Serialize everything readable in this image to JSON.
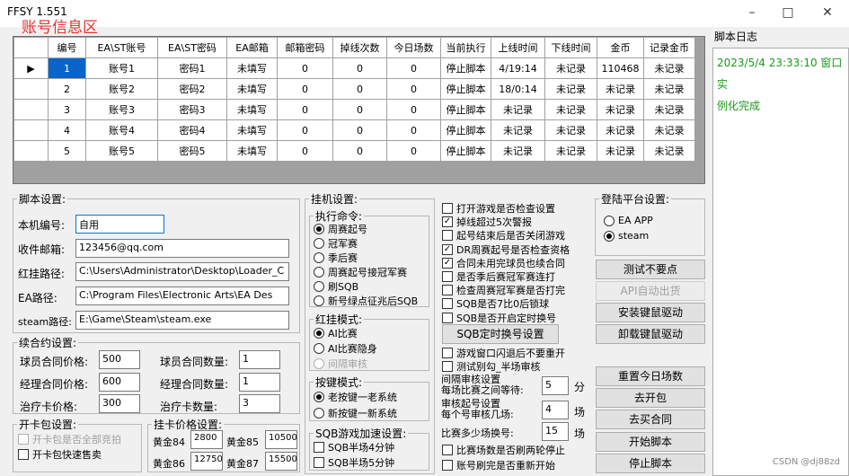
{
  "window": {
    "title": "FFSY 1.551",
    "overlay_label": "账号信息区",
    "minimize": "–",
    "maximize": "□",
    "close": "✕"
  },
  "table": {
    "headers": [
      "编号",
      "EA\\ST账号",
      "EA\\ST密码",
      "EA邮箱",
      "邮箱密码",
      "掉线次数",
      "今日场数",
      "当前执行",
      "上线时间",
      "下线时间",
      "金币",
      "记录金币"
    ],
    "rows": [
      [
        "1",
        "账号1",
        "密码1",
        "未填写",
        "0",
        "0",
        "0",
        "停止脚本",
        "4/19:14",
        "未记录",
        "110468",
        "未记录"
      ],
      [
        "2",
        "账号2",
        "密码2",
        "未填写",
        "0",
        "0",
        "0",
        "停止脚本",
        "18/0:14",
        "未记录",
        "未记录",
        "未记录"
      ],
      [
        "3",
        "账号3",
        "密码3",
        "未填写",
        "0",
        "0",
        "0",
        "停止脚本",
        "未记录",
        "未记录",
        "未记录",
        "未记录"
      ],
      [
        "4",
        "账号4",
        "密码4",
        "未填写",
        "0",
        "0",
        "0",
        "停止脚本",
        "未记录",
        "未记录",
        "未记录",
        "未记录"
      ],
      [
        "5",
        "账号5",
        "密码5",
        "未填写",
        "0",
        "0",
        "0",
        "停止脚本",
        "未记录",
        "未记录",
        "未记录",
        "未记录"
      ]
    ],
    "current_row_marker": "▶"
  },
  "script_settings": {
    "legend": "脚本设置:",
    "machine_label": "本机编号:",
    "machine_value": "自用",
    "email_label": "收件邮箱:",
    "email_value": "123456@qq.com",
    "redhang_label": "红挂路径:",
    "redhang_value": "C:\\Users\\Administrator\\Desktop\\Loader_C",
    "ea_label": "EA路径:",
    "ea_value": "C:\\Program Files\\Electronic Arts\\EA Des",
    "steam_label": "steam路径:",
    "steam_value": "E:\\Game\\Steam\\steam.exe"
  },
  "contract": {
    "legend": "续合约设置:",
    "player_price_label": "球员合同价格:",
    "player_price": "500",
    "player_qty_label": "球员合同数量:",
    "player_qty": "1",
    "manager_price_label": "经理合同价格:",
    "manager_price": "600",
    "manager_qty_label": "经理合同数量:",
    "manager_qty": "1",
    "heal_price_label": "治疗卡价格:",
    "heal_price": "300",
    "heal_qty_label": "治疗卡数量:",
    "heal_qty": "3"
  },
  "pack": {
    "legend": "开卡包设置:",
    "opt1": "开卡包是否全部竞拍",
    "opt2": "开卡包快速售卖"
  },
  "card_price": {
    "legend": "挂卡价格设置:",
    "g84_label": "黄金84",
    "g84": "2800",
    "g85_label": "黄金85",
    "g85": "10500",
    "g86_label": "黄金86",
    "g86": "12750",
    "g87_label": "黄金87",
    "g87": "15500"
  },
  "hang": {
    "legend": "挂机设置:",
    "exec_legend": "执行命令:",
    "exec_options": [
      "周赛起号",
      "冠军赛",
      "季后赛",
      "周赛起号接冠军赛",
      "刷SQB",
      "新号绿点征兆后SQB"
    ],
    "mode_legend": "红挂模式:",
    "mode_options": [
      "AI比赛",
      "AI比赛隐身",
      "间隔审核"
    ],
    "key_legend": "按键模式:",
    "key_options": [
      "老按键一老系统",
      "新按键一新系统"
    ],
    "sqb_legend": "SQB游戏加速设置:",
    "sqb_options": [
      "SQB半场4分钟",
      "SQB半场5分钟"
    ]
  },
  "checks": {
    "items1": [
      "打开游戏是否检查设置",
      "掉线超过5次警报",
      "起号结束后是否关闭游戏",
      "DR周赛起号是否检查资格",
      "合同未用完球员也续合同",
      "是否季后赛冠军赛连打",
      "检查周赛冠军赛是否打完",
      "SQB是否7比0后锁球",
      "SQB是否开启定时换号"
    ],
    "items1_checked": [
      false,
      true,
      false,
      true,
      true,
      false,
      false,
      false,
      false
    ],
    "sqb_timer_button": "SQB定时换号设置",
    "items2": [
      "游戏窗口闪退后不要重开",
      "测试别勾_半场审核"
    ],
    "interval_label1": "间隔审核设置",
    "interval_label2": "每场比赛之间等待:",
    "interval_value": "5",
    "interval_unit": "分",
    "review_label1": "审核起号设置",
    "review_label2": "每个号审核几场:",
    "review_value": "4",
    "review_unit": "场",
    "switch_label": "比赛多少场换号:",
    "switch_value": "15",
    "switch_unit": "场",
    "items3": [
      "比赛场数是否刷两轮停止",
      "账号刷完是否重新开始"
    ]
  },
  "platform": {
    "legend": "登陆平台设置:",
    "options": [
      "EA APP",
      "steam"
    ]
  },
  "buttons": {
    "test": "测试不要点",
    "api": "API自动出货",
    "install": "安装键鼠驱动",
    "uninstall": "卸载键鼠驱动",
    "reset": "重置今日场数",
    "open_pack": "去开包",
    "buy_contract": "去买合同",
    "start": "开始脚本",
    "stop": "停止脚本"
  },
  "log": {
    "title": "脚本日志",
    "lines": [
      "2023/5/4 23:33:10 窗口实",
      "例化完成"
    ]
  },
  "watermark": "CSDN @dj88zd"
}
